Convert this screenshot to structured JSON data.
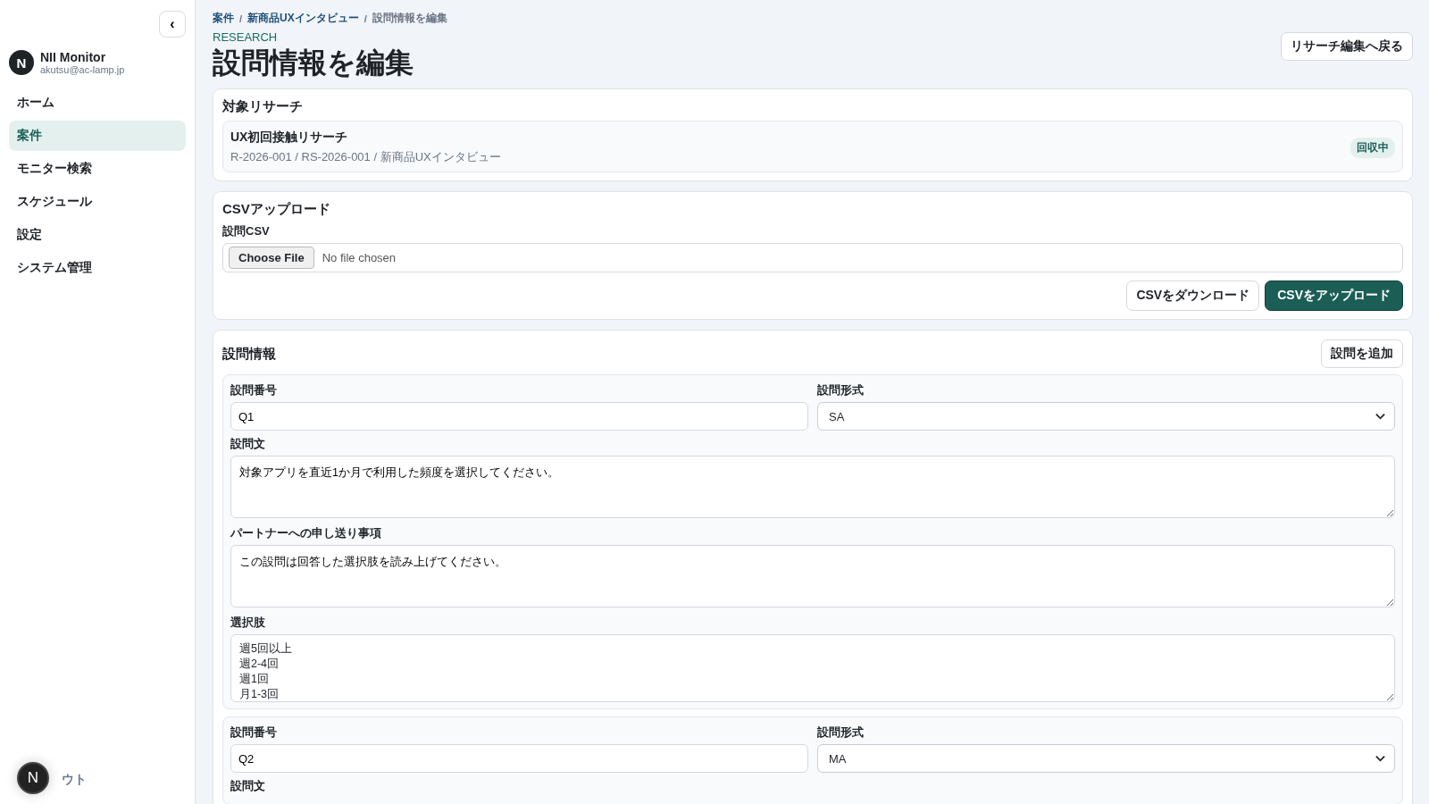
{
  "sidebar": {
    "collapse_button": "‹",
    "user": {
      "initial": "N",
      "name": "NII Monitor",
      "email": "akutsu@ac-lamp.jp"
    },
    "items": [
      {
        "label": "ホーム",
        "selected": false
      },
      {
        "label": "案件",
        "selected": true
      },
      {
        "label": "モニター検索",
        "selected": false
      },
      {
        "label": "スケジュール",
        "selected": false
      },
      {
        "label": "設定",
        "selected": false
      },
      {
        "label": "システム管理",
        "selected": false
      }
    ],
    "logout": "ウト",
    "dev_badge": "N"
  },
  "breadcrumb_separator": "/",
  "breadcrumb": [
    {
      "label": "案件",
      "link": true
    },
    {
      "label": "新商品UXインタビュー",
      "link": true
    },
    {
      "label": "設問情報を編集",
      "link": false
    }
  ],
  "eyebrow": "RESEARCH",
  "title": "設問情報を編集",
  "back_button": "リサーチ編集へ戻る",
  "target": {
    "heading": "対象リサーチ",
    "name": "UX初回接触リサーチ",
    "meta": "R-2026-001 / RS-2026-001 / 新商品UXインタビュー",
    "status": "回収中"
  },
  "csv": {
    "heading": "CSVアップロード",
    "label": "設問CSV",
    "choose_button": "Choose File",
    "file_status": "No file chosen",
    "download_button": "CSVをダウンロード",
    "upload_button": "CSVをアップロード"
  },
  "questions_section": {
    "heading": "設問情報",
    "add_button": "設問を追加",
    "questions": [
      {
        "number_label": "設問番号",
        "number": "Q1",
        "format_label": "設問形式",
        "format": "SA",
        "fields": [
          {
            "label": "設問文",
            "value": "対象アプリを直近1か月で利用した頻度を選択してください。"
          },
          {
            "label": "パートナーへの申し送り事項",
            "value": "この設問は回答した選択肢を読み上げてください。"
          },
          {
            "label": "選択肢",
            "options": [
              "週5回以上",
              "週2-4回",
              "週1回",
              "月1-3回"
            ]
          }
        ]
      },
      {
        "number_label": "設問番号",
        "number": "Q2",
        "format_label": "設問形式",
        "format": "MA",
        "fields": [
          {
            "label": "設問文"
          }
        ]
      }
    ]
  }
}
